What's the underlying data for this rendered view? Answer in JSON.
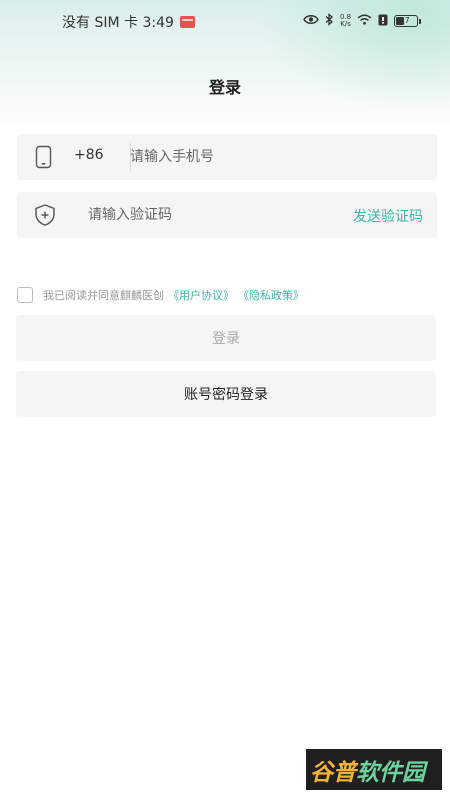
{
  "status_bar": {
    "carrier_time": "没有 SIM 卡 3:49",
    "speed_value": "0.8",
    "speed_unit": "K/s",
    "battery": "37"
  },
  "page": {
    "title": "登录"
  },
  "phone_field": {
    "country_code": "+86",
    "placeholder": "请输入手机号",
    "value": ""
  },
  "code_field": {
    "placeholder": "请输入验证码",
    "value": "",
    "send_code_label": "发送验证码"
  },
  "agreement": {
    "text": "我已阅读并同意麒麟医创",
    "user_agreement": "《用户协议》",
    "privacy_policy": "《隐私政策》",
    "checked": false
  },
  "buttons": {
    "login": "登录",
    "account_login": "账号密码登录"
  },
  "watermark": {
    "part1": "谷普",
    "part2": "软件园"
  },
  "colors": {
    "accent": "#3bb5a8",
    "field_bg": "#f5f5f5",
    "header_tint": "#d9eeea"
  }
}
